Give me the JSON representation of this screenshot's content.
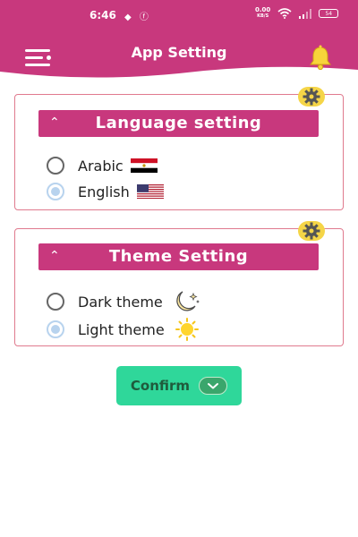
{
  "status_bar": {
    "time": "6:46",
    "left_icons": "◆ ⓕ",
    "net_speed_value": "0.00",
    "net_speed_unit": "KB/S",
    "battery": "54"
  },
  "header": {
    "title": "App Setting",
    "menu_icon": "menu-icon",
    "bell_icon": "bell-icon"
  },
  "language_section": {
    "title": "Language setting",
    "options": [
      {
        "label": "Arabic",
        "selected": false,
        "flag": "egypt-flag"
      },
      {
        "label": "English",
        "selected": true,
        "flag": "us-flag"
      }
    ]
  },
  "theme_section": {
    "title": "Theme Setting",
    "options": [
      {
        "label": "Dark theme",
        "selected": false,
        "icon": "moon-icon"
      },
      {
        "label": "Light theme",
        "selected": true,
        "icon": "sun-icon"
      }
    ]
  },
  "confirm": {
    "label": "Confirm"
  },
  "colors": {
    "brand": "#c8387d",
    "panel_border": "#e07a8e",
    "confirm_bg": "#2fd79a",
    "badge": "#f5d547"
  }
}
